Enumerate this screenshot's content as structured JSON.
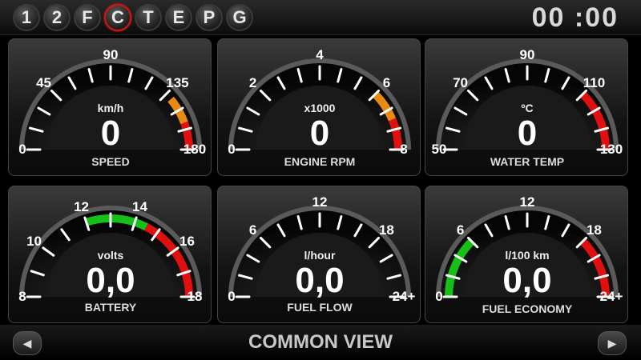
{
  "header": {
    "tabs": [
      {
        "label": "1",
        "active": false
      },
      {
        "label": "2",
        "active": false
      },
      {
        "label": "F",
        "active": false
      },
      {
        "label": "C",
        "active": true
      },
      {
        "label": "T",
        "active": false
      },
      {
        "label": "E",
        "active": false
      },
      {
        "label": "P",
        "active": false
      },
      {
        "label": "G",
        "active": false
      }
    ],
    "clock": "00 :00"
  },
  "gauges": [
    {
      "id": "speed",
      "name": "SPEED",
      "unit": "km/h",
      "value": "0",
      "min": 0,
      "max": 180,
      "labels": [
        "0",
        "45",
        "90",
        "135",
        "180"
      ],
      "label_values": [
        0,
        45,
        90,
        135,
        180
      ],
      "minor_step": 15,
      "bands": [
        {
          "from": 140,
          "to": 160,
          "color": "#e88a12"
        },
        {
          "from": 160,
          "to": 180,
          "color": "#e01010"
        }
      ]
    },
    {
      "id": "rpm",
      "name": "ENGINE RPM",
      "unit": "x1000",
      "value": "0",
      "min": 0,
      "max": 8,
      "labels": [
        "0",
        "2",
        "4",
        "6",
        "8"
      ],
      "label_values": [
        0,
        2,
        4,
        6,
        8
      ],
      "minor_step": 0.666666,
      "bands": [
        {
          "from": 6,
          "to": 7,
          "color": "#e88a12"
        },
        {
          "from": 7,
          "to": 8,
          "color": "#e01010"
        }
      ]
    },
    {
      "id": "water",
      "name": "WATER TEMP",
      "unit": "ºC",
      "value": "0",
      "min": 50,
      "max": 130,
      "labels": [
        "50",
        "70",
        "90",
        "110",
        "130"
      ],
      "label_values": [
        50,
        70,
        90,
        110,
        130
      ],
      "minor_step": 6.666666,
      "bands": [
        {
          "from": 110,
          "to": 130,
          "color": "#e01010"
        }
      ]
    },
    {
      "id": "battery",
      "name": "BATTERY",
      "unit": "volts",
      "value": "0,0",
      "min": 8,
      "max": 18,
      "labels": [
        "8",
        "10",
        "12",
        "14",
        "16",
        "18"
      ],
      "label_values": [
        8,
        10,
        12,
        14,
        16,
        18
      ],
      "minor_step": 1,
      "bands": [
        {
          "from": 12,
          "to": 14.5,
          "color": "#16c016"
        },
        {
          "from": 14.5,
          "to": 18,
          "color": "#e01010"
        }
      ]
    },
    {
      "id": "fuelflow",
      "name": "FUEL FLOW",
      "unit": "l/hour",
      "value": "0,0",
      "min": 0,
      "max": 24,
      "labels": [
        "0",
        "6",
        "12",
        "18",
        "24+"
      ],
      "label_values": [
        0,
        6,
        12,
        18,
        24
      ],
      "minor_step": 2,
      "bands": []
    },
    {
      "id": "economy",
      "name": "FUEL ECONOMY",
      "unit": "l/100 km",
      "value": "0,0",
      "min": 0,
      "max": 24,
      "labels": [
        "0",
        "6",
        "12",
        "18",
        "24+"
      ],
      "label_values": [
        0,
        6,
        12,
        18,
        24
      ],
      "minor_step": 2,
      "bands": [
        {
          "from": 0,
          "to": 6,
          "color": "#16c016"
        },
        {
          "from": 18,
          "to": 24,
          "color": "#e01010"
        }
      ]
    }
  ],
  "footer": {
    "title": "COMMON VIEW",
    "prev_icon": "left-arrow-icon",
    "next_icon": "right-arrow-icon"
  },
  "colors": {
    "accent": "#d41414",
    "panel": "#1c1c1c",
    "tick": "#ffffff"
  }
}
